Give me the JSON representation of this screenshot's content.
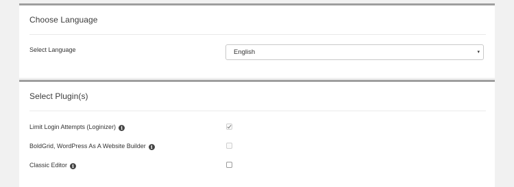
{
  "language_section": {
    "title": "Choose Language",
    "select_label": "Select Language",
    "selected_language": "English",
    "caret": "▾"
  },
  "plugins_section": {
    "title": "Select Plugin(s)",
    "info_glyph": "i",
    "plugins": [
      {
        "label": "Limit Login Attempts (Loginizer)",
        "checked": true,
        "disabled": true
      },
      {
        "label": "BoldGrid, WordPress As A Website Builder",
        "checked": false,
        "disabled": true
      },
      {
        "label": "Classic Editor",
        "checked": false,
        "disabled": false
      }
    ]
  }
}
